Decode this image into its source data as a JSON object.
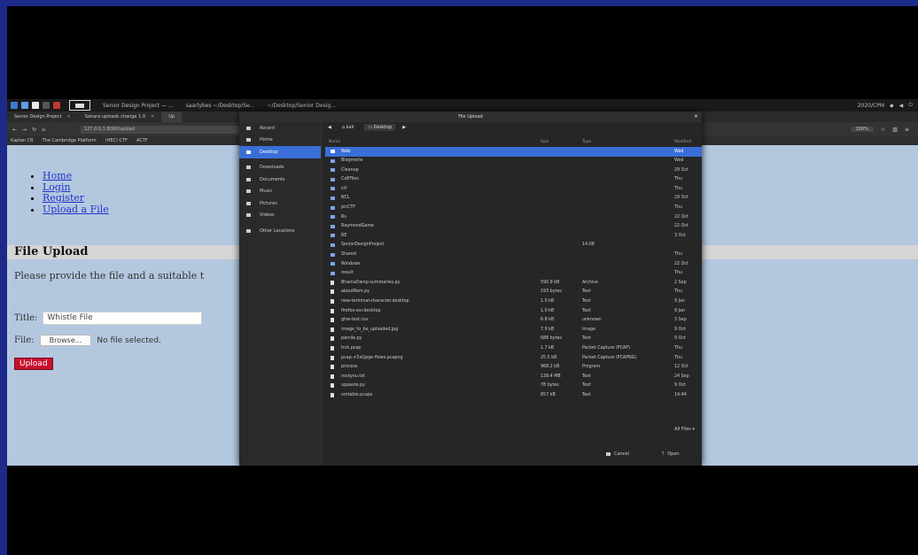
{
  "panel": {
    "tasks": [
      "Senior Design Project — ...",
      "saarlybes ~/Desktop/Se...",
      "~/Desktop/Senior Desig..."
    ],
    "tray": "2020/CPM"
  },
  "browser": {
    "tabs": [
      {
        "label": "Senior Design Project"
      },
      {
        "label": "Sahara uploads change 1.0"
      },
      {
        "label": "Up"
      }
    ],
    "url": "127.0.0.1:8000/upload",
    "zoom": "100%",
    "bookmarks": [
      "Kaplan CR",
      "The Cambridge Platform",
      "(HEC) CTF",
      "ACTF"
    ]
  },
  "page": {
    "nav": [
      "Home",
      "Login",
      "Register",
      "Upload a File"
    ],
    "heading": "File Upload",
    "description": "Please provide the file and a suitable t",
    "title_label": "Title:",
    "title_value": "Whistle File",
    "file_label": "File:",
    "browse_label": "Browse...",
    "no_file_text": "No file selected.",
    "upload_label": "Upload"
  },
  "dialog": {
    "title": "File Upload",
    "sidebar": [
      {
        "label": "Recent",
        "active": false
      },
      {
        "label": "Home",
        "active": false
      },
      {
        "label": "Desktop",
        "active": true
      },
      {
        "label": "Downloads",
        "active": false
      },
      {
        "label": "Documents",
        "active": false
      },
      {
        "label": "Music",
        "active": false
      },
      {
        "label": "Pictures",
        "active": false
      },
      {
        "label": "Videos",
        "active": false
      },
      {
        "label": "Other Locations",
        "active": false
      }
    ],
    "path": [
      "kali",
      "Desktop"
    ],
    "columns": {
      "name": "Name",
      "size": "Size",
      "type": "Type",
      "modified": "Modified"
    },
    "files": [
      {
        "name": "Web",
        "size": "",
        "type": "",
        "modified": "Wed",
        "folder": true,
        "selected": true
      },
      {
        "name": "Blogmerle",
        "size": "",
        "type": "",
        "modified": "Wed",
        "folder": true
      },
      {
        "name": "Cleanup",
        "size": "",
        "type": "",
        "modified": "29 Oct",
        "folder": true
      },
      {
        "name": "CoEFiles",
        "size": "",
        "type": "",
        "modified": "Thu",
        "folder": true
      },
      {
        "name": "ctf",
        "size": "",
        "type": "",
        "modified": "Thu",
        "folder": true
      },
      {
        "name": "NCL",
        "size": "",
        "type": "",
        "modified": "29 Oct",
        "folder": true
      },
      {
        "name": "picCTF",
        "size": "",
        "type": "",
        "modified": "Thu",
        "folder": true
      },
      {
        "name": "Rs",
        "size": "",
        "type": "",
        "modified": "22 Oct",
        "folder": true
      },
      {
        "name": "RaymondGame",
        "size": "",
        "type": "",
        "modified": "22 Oct",
        "folder": true
      },
      {
        "name": "RE",
        "size": "",
        "type": "",
        "modified": "3 Oct",
        "folder": true
      },
      {
        "name": "SeniorDesignProject",
        "size": "",
        "type": "14:08",
        "modified": "",
        "folder": true
      },
      {
        "name": "Shared",
        "size": "",
        "type": "",
        "modified": "Thu",
        "folder": true
      },
      {
        "name": "Windows",
        "size": "",
        "type": "",
        "modified": "22 Oct",
        "folder": true
      },
      {
        "name": "result",
        "size": "",
        "type": "",
        "modified": "Thu",
        "folder": true
      },
      {
        "name": "BhamaOwnp-summaries.py",
        "size": "590.9 kB",
        "type": "Archive",
        "modified": "2 Sep",
        "folder": false
      },
      {
        "name": "aboutRom.py",
        "size": "193 bytes",
        "type": "Text",
        "modified": "Thu",
        "folder": false
      },
      {
        "name": "new-terminal-character.desktop",
        "size": "1.0 kB",
        "type": "Text",
        "modified": "9 Jan",
        "folder": false
      },
      {
        "name": "firefox-esr.desktop",
        "size": "1.0 kB",
        "type": "Text",
        "modified": "9 Jan",
        "folder": false
      },
      {
        "name": "ghw-test.csv",
        "size": "6.8 kB",
        "type": "unknown",
        "modified": "3 Sep",
        "folder": false
      },
      {
        "name": "image_to_be_uploaded.jpg",
        "size": "7.9 kB",
        "type": "Image",
        "modified": "9 Oct",
        "folder": false
      },
      {
        "name": "parcile.py",
        "size": "688 bytes",
        "type": "Text",
        "modified": "9 Oct",
        "folder": false
      },
      {
        "name": "trck.pcap",
        "size": "1.7 kB",
        "type": "Packet Capture (PCAP)",
        "modified": "Thu",
        "folder": false
      },
      {
        "name": "pcap-+5xQpge-flows.pcapng",
        "size": "25.5 kB",
        "type": "Packet Capture (PCAPNG)",
        "modified": "Thu",
        "folder": false
      },
      {
        "name": "process",
        "size": "968.2 kB",
        "type": "Program",
        "modified": "12 Oct",
        "folder": false
      },
      {
        "name": "rockyou.txt",
        "size": "138.4 MB",
        "type": "Text",
        "modified": "24 Sep",
        "folder": false
      },
      {
        "name": "uppaste.py",
        "size": "78 bytes",
        "type": "Text",
        "modified": "9 Oct",
        "folder": false
      },
      {
        "name": "vmtable.pcaps",
        "size": "857 kB",
        "type": "Text",
        "modified": "14:44",
        "folder": false
      }
    ],
    "filter": "All Files",
    "cancel_label": "Cancel",
    "open_label": "Open"
  }
}
